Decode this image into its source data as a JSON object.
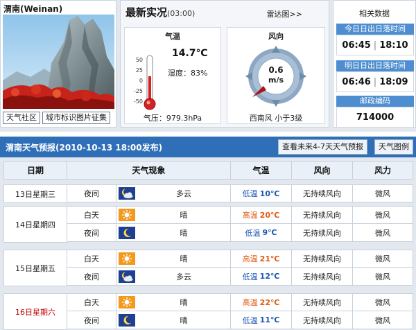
{
  "city": {
    "name": "渭南(Weinan)",
    "links": [
      "天气社区",
      "城市标识图片征集"
    ]
  },
  "now": {
    "title": "最新实况",
    "time": "(03:00)",
    "radar_link": "雷达图>>",
    "temp_title": "气温",
    "temp": "14.7℃",
    "humidity": "湿度：83%",
    "pressure": "气压：979.3hPa",
    "thermometer_ticks": [
      "50",
      "25",
      "0",
      "-25",
      "-50"
    ],
    "wind_title": "风向",
    "wind_speed": "0.6",
    "wind_unit": "m/s",
    "wind_desc": "西南风 小于3级"
  },
  "related": {
    "title": "相关数据",
    "today_label": "今日日出日落时间",
    "today_sunrise": "06:45",
    "today_sunset": "18:10",
    "tomorrow_label": "明日日出日落时间",
    "tomorrow_sunrise": "06:46",
    "tomorrow_sunset": "18:09",
    "postcode_label": "邮政编码",
    "postcode": "714000"
  },
  "forecast": {
    "title": "渭南天气预报(2010-10-13  18:00发布)",
    "btn_4to7": "查看未来4-7天天气预报",
    "btn_legend": "天气图例",
    "headers": {
      "date": "日期",
      "phenomenon": "天气现象",
      "temp": "气温",
      "wind_dir": "风向",
      "wind_force": "风力"
    },
    "hi_label": "高温",
    "lo_label": "低温",
    "days": [
      {
        "date": "13日星期三",
        "rows": [
          {
            "period": "夜间",
            "icon": "cloudy-night-icon",
            "desc": "多云",
            "kind": "lo",
            "temp": "10℃",
            "dir": "无持续风向",
            "force": "微风"
          }
        ]
      },
      {
        "date": "14日星期四",
        "rows": [
          {
            "period": "白天",
            "icon": "sunny-icon",
            "desc": "晴",
            "kind": "hi",
            "temp": "20℃",
            "dir": "无持续风向",
            "force": "微风"
          },
          {
            "period": "夜间",
            "icon": "clear-night-icon",
            "desc": "晴",
            "kind": "lo",
            "temp": "9℃",
            "dir": "无持续风向",
            "force": "微风"
          }
        ]
      },
      {
        "date": "15日星期五",
        "rows": [
          {
            "period": "白天",
            "icon": "sunny-icon",
            "desc": "晴",
            "kind": "hi",
            "temp": "21℃",
            "dir": "无持续风向",
            "force": "微风"
          },
          {
            "period": "夜间",
            "icon": "cloudy-night-icon",
            "desc": "多云",
            "kind": "lo",
            "temp": "12℃",
            "dir": "无持续风向",
            "force": "微风"
          }
        ]
      },
      {
        "date": "16日星期六",
        "weekend": true,
        "rows": [
          {
            "period": "白天",
            "icon": "sunny-icon",
            "desc": "晴",
            "kind": "hi",
            "temp": "22℃",
            "dir": "无持续风向",
            "force": "微风"
          },
          {
            "period": "夜间",
            "icon": "clear-night-icon",
            "desc": "晴",
            "kind": "lo",
            "temp": "11℃",
            "dir": "无持续风向",
            "force": "微风"
          }
        ]
      }
    ]
  }
}
